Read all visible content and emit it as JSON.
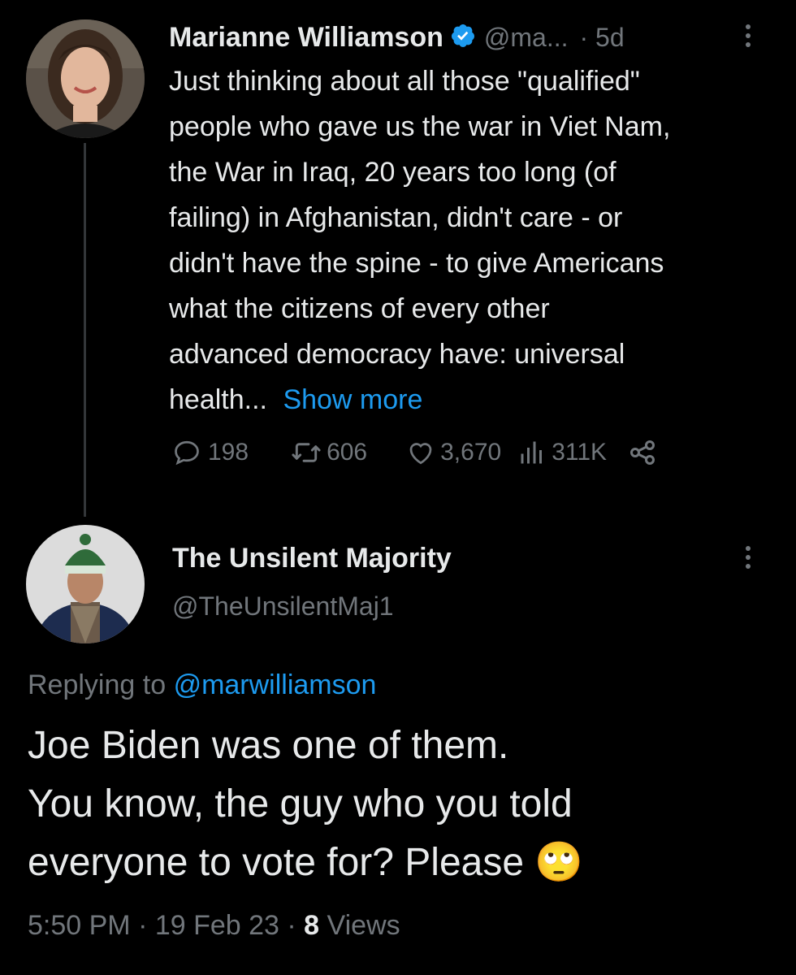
{
  "original_tweet": {
    "author_name": "Marianne Williamson",
    "handle": "@ma...",
    "time": "· 5d",
    "lines": [
      "Just thinking about all those \"qualified\"",
      "people who gave us the war in Viet Nam,",
      "the War in Iraq, 20 years too long (of",
      "failing) in Afghanistan, didn't care - or",
      "didn't have the spine - to give Americans",
      "what the citizens of every other",
      "advanced democracy have: universal"
    ],
    "last_line_text": "health...",
    "show_more": "Show more",
    "stats": {
      "replies": "198",
      "retweets": "606",
      "likes": "3,670",
      "views": "311K"
    }
  },
  "reply_tweet": {
    "author_name": "The Unsilent Majority",
    "handle": "@TheUnsilentMaj1",
    "replying_to_label": "Replying to",
    "replying_to_handle": "@marwilliamson",
    "lines": [
      "Joe Biden was one of them.",
      "You know, the guy who you told",
      "everyone to vote for? Please"
    ],
    "emoji": "🙄",
    "timestamp": "5:50 PM · 19 Feb 23 · ",
    "views_count": "8",
    "views_label": " Views"
  },
  "icons": {
    "verified": "verified-badge-icon",
    "more": "more-dots-icon",
    "reply": "reply-icon",
    "retweet": "retweet-icon",
    "like": "heart-icon",
    "views": "views-bars-icon",
    "share": "share-icon"
  },
  "colors": {
    "background": "#000000",
    "text": "#e7e9ea",
    "muted": "#71767b",
    "link": "#1d9bf0"
  }
}
